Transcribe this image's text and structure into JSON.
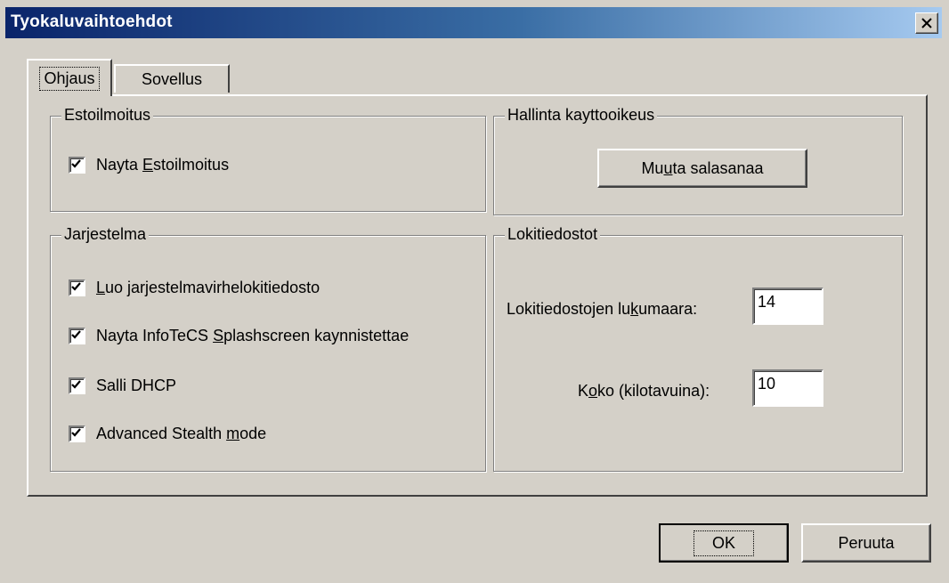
{
  "window": {
    "title": "Tyokaluvaihtoehdot"
  },
  "tabs": [
    {
      "label": "Ohjaus",
      "active": true
    },
    {
      "label": "Sovellus",
      "active": false
    }
  ],
  "estoilmoitus": {
    "title": "Estoilmoitus",
    "show_block": {
      "label_pre": "Nayta ",
      "label_ul": "E",
      "label_post": "stoilmoitus",
      "checked": true
    }
  },
  "hallinta": {
    "title": "Hallinta kayttooikeus",
    "change_password": {
      "pre": "Mu",
      "ul": "u",
      "post": "ta salasanaa"
    }
  },
  "jarjestelma": {
    "title": "Jarjestelma",
    "items": [
      {
        "pre": "",
        "ul": "L",
        "post": "uo jarjestelmavirhelokitiedosto",
        "checked": true
      },
      {
        "pre": "Nayta InfoTeCS ",
        "ul": "S",
        "post": "plashscreen kaynnistettae",
        "checked": true
      },
      {
        "pre": "Salli DHCP",
        "ul": "",
        "post": "",
        "checked": true
      },
      {
        "pre": "Advanced Stealth ",
        "ul": "m",
        "post": "ode",
        "checked": true
      }
    ]
  },
  "lokitiedostot": {
    "title": "Lokitiedostot",
    "count": {
      "pre": "Lokitiedostojen lu",
      "ul": "k",
      "post": "umaara:",
      "value": "14"
    },
    "size": {
      "pre": "K",
      "ul": "o",
      "post": "ko (kilotavuina):",
      "value": "10"
    }
  },
  "buttons": {
    "ok": "OK",
    "cancel": "Peruuta"
  }
}
